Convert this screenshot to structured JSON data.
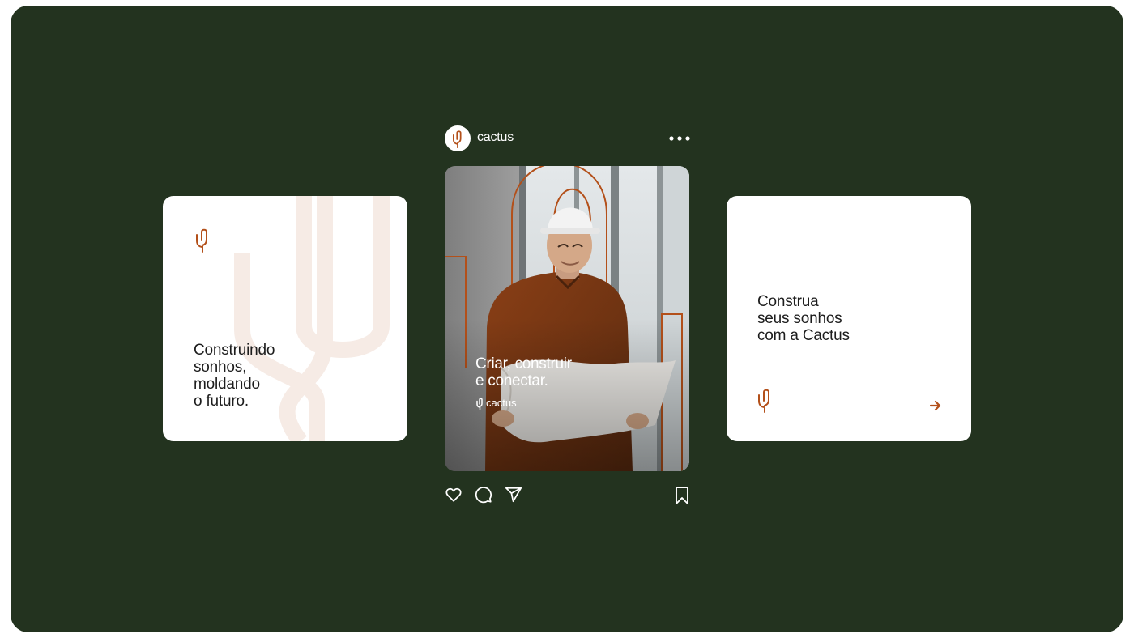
{
  "colors": {
    "background": "#23331f",
    "card": "#ffffff",
    "accent": "#b3501a",
    "watermark": "#f6ebe5",
    "text_dark": "#1d1d1d",
    "text_light": "#ffffff"
  },
  "left_card": {
    "logo_icon": "cactus-logo-icon",
    "headline": [
      "Construindo",
      "sonhos,",
      "moldando",
      "o futuro."
    ]
  },
  "post": {
    "avatar_icon": "cactus-logo-icon",
    "username": "cactus",
    "more_icon": "more-horizontal-icon",
    "photo_headline": [
      "Criar, construir",
      "e conectar."
    ],
    "photo_brand": "cactus",
    "actions": [
      "heart-icon",
      "comment-icon",
      "share-icon",
      "bookmark-icon"
    ]
  },
  "right_card": {
    "headline": [
      "Construa",
      "seus sonhos",
      "com a Cactus"
    ],
    "logo_icon": "cactus-logo-icon",
    "arrow_icon": "arrow-right-icon"
  }
}
